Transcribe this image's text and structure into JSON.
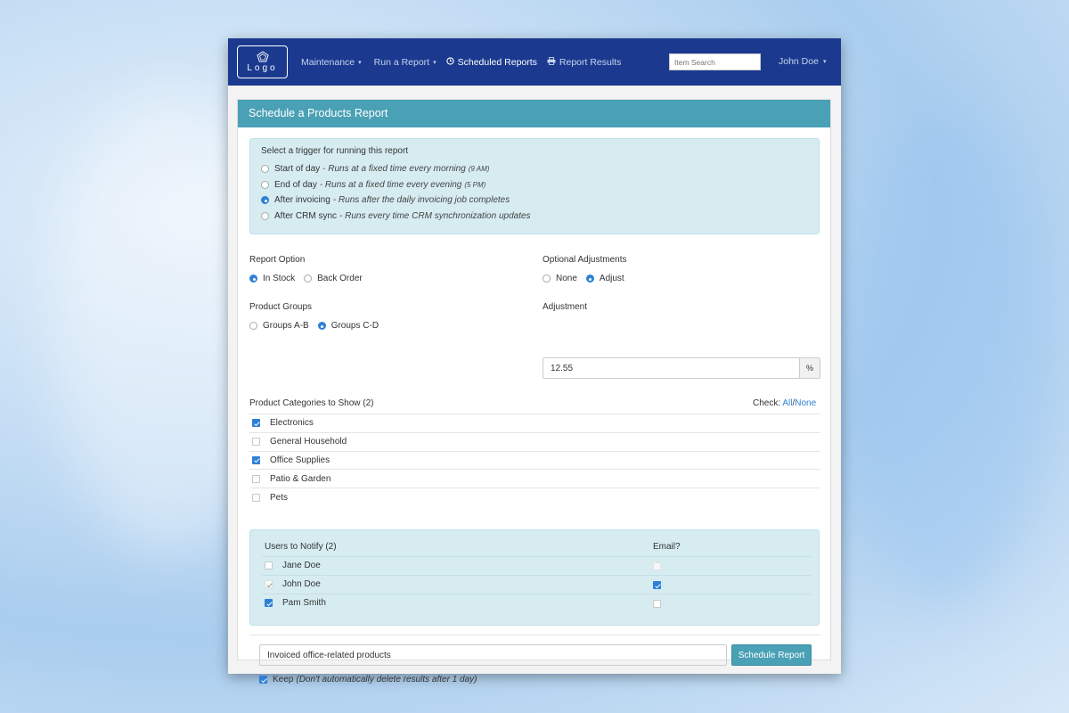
{
  "nav": {
    "logo_text": "Logo",
    "items": [
      {
        "label": "Maintenance",
        "caret": "▾"
      },
      {
        "label": "Run a Report",
        "caret": "▾"
      },
      {
        "label": "Scheduled Reports",
        "icon": "clock-icon"
      },
      {
        "label": "Report Results",
        "icon": "printer-icon"
      }
    ],
    "search_placeholder": "Item Search",
    "user_name": "John Doe",
    "user_caret": "▾",
    "bar_color": "#1b3a8f"
  },
  "panel": {
    "title": "Schedule a Products Report",
    "header_color": "#4aa0b5"
  },
  "trigger": {
    "title": "Select a trigger for running this report",
    "options": [
      {
        "label": "Start of day",
        "desc": "- Runs at a fixed time every morning",
        "small": "(9 AM)",
        "selected": false
      },
      {
        "label": "End of day",
        "desc": "- Runs at a fixed time every evening",
        "small": "(5 PM)",
        "selected": false
      },
      {
        "label": "After invoicing",
        "desc": "- Runs after the daily invoicing job completes",
        "small": "",
        "selected": true
      },
      {
        "label": "After CRM sync",
        "desc": "- Runs every time CRM synchronization updates",
        "small": "",
        "selected": false
      }
    ]
  },
  "report_option": {
    "label": "Report Option",
    "options": [
      {
        "label": "In Stock",
        "selected": true
      },
      {
        "label": "Back Order",
        "selected": false
      }
    ]
  },
  "optional_adjustments": {
    "label": "Optional Adjustments",
    "options": [
      {
        "label": "None",
        "selected": false
      },
      {
        "label": "Adjust",
        "selected": true
      }
    ]
  },
  "product_groups": {
    "label": "Product Groups",
    "options": [
      {
        "label": "Groups A-B",
        "selected": false
      },
      {
        "label": "Groups C-D",
        "selected": true
      }
    ]
  },
  "adjustment": {
    "label": "Adjustment",
    "value": "12.55",
    "addon": "%"
  },
  "categories": {
    "label": "Product Categories to Show (2)",
    "check_label": "Check:",
    "all_label": "All",
    "slash": "/",
    "none_label": "None",
    "items": [
      {
        "label": "Electronics",
        "checked": true
      },
      {
        "label": "General Household",
        "checked": false
      },
      {
        "label": "Office Supplies",
        "checked": true
      },
      {
        "label": "Patio & Garden",
        "checked": false
      },
      {
        "label": "Pets",
        "checked": false
      }
    ]
  },
  "users": {
    "label": "Users to Notify (2)",
    "email_label": "Email?",
    "items": [
      {
        "name": "Jane Doe",
        "state": "off",
        "email": "disabled"
      },
      {
        "name": "John Doe",
        "state": "light",
        "email": "on"
      },
      {
        "name": "Pam Smith",
        "state": "on",
        "email": "off"
      }
    ]
  },
  "footer": {
    "description_value": "Invoiced office-related products",
    "schedule_button": "Schedule Report",
    "keep_label": "Keep",
    "keep_note": "(Don't automatically delete results after 1 day)",
    "keep_checked": true
  }
}
